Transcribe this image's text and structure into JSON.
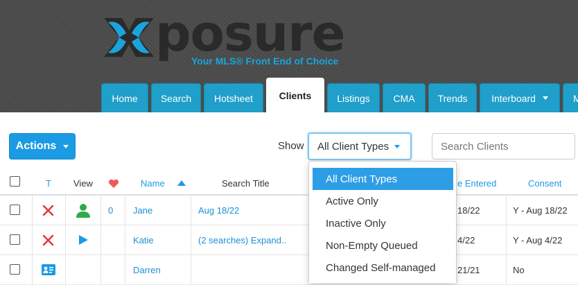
{
  "brand": {
    "name": "posure",
    "tagline": "Your MLS® Front End of Choice",
    "colors": {
      "blue": "#1aa4dc",
      "dark": "#2a2a2a"
    }
  },
  "nav": {
    "tabs": [
      {
        "label": "Home"
      },
      {
        "label": "Search"
      },
      {
        "label": "Hotsheet"
      },
      {
        "label": "Clients",
        "active": true
      },
      {
        "label": "Listings"
      },
      {
        "label": "CMA"
      },
      {
        "label": "Trends"
      },
      {
        "label": "Interboard",
        "has_dropdown": true
      },
      {
        "label": "M"
      }
    ]
  },
  "toolbar": {
    "actions_label": "Actions",
    "show_label": "Show",
    "client_type_selected": "All Client Types",
    "search_placeholder": "Search Clients"
  },
  "client_type_menu": {
    "options": [
      "All Client Types",
      "Active Only",
      "Inactive Only",
      "Non-Empty Queued",
      "Changed Self-managed"
    ],
    "selected_index": 0
  },
  "table": {
    "headers": {
      "t": "T",
      "view": "View",
      "name": "Name",
      "search_title": "Search Title",
      "date_entered": "e Entered",
      "consent": "Consent"
    },
    "rows": [
      {
        "status_icon": "x-icon",
        "view_icon": "person-icon",
        "favorites": "0",
        "name": "Jane",
        "search_title": "Aug 18/22",
        "date_entered": "18/22",
        "consent": "Y - Aug 18/22"
      },
      {
        "status_icon": "x-icon",
        "view_icon": "play-icon",
        "favorites": "",
        "name": "Katie",
        "search_title": "(2 searches) Expand..",
        "date_entered": "4/22",
        "consent": "Y - Aug 4/22"
      },
      {
        "status_icon": "contact-card-icon",
        "view_icon": "",
        "favorites": "",
        "name": "Darren",
        "search_title": "",
        "date_entered": "21/21",
        "consent": "No"
      }
    ]
  }
}
